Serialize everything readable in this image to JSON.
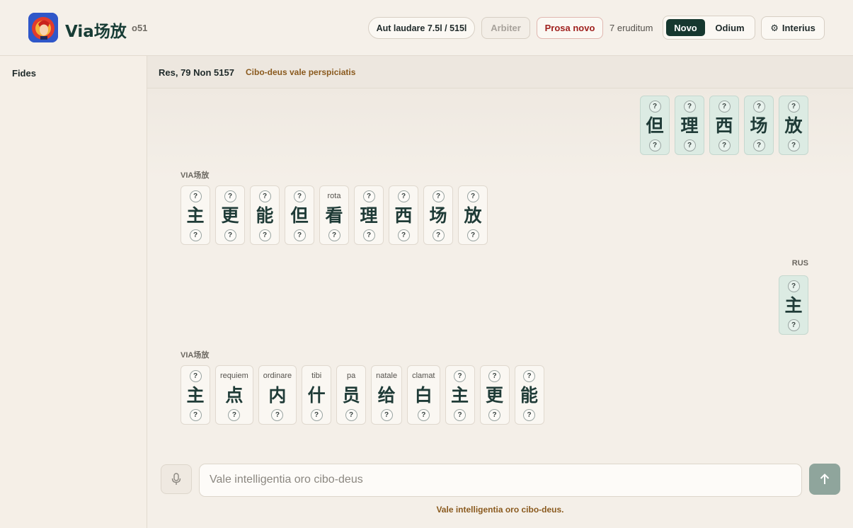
{
  "header": {
    "app_title": "Via场放",
    "version": "o51",
    "quota_label": "Aut laudare 7.5l / 515l",
    "arbiter_label": "Arbiter",
    "prosa_label": "Prosa novo",
    "eruditum_label": "7 eruditum",
    "mode_novo": "Novo",
    "mode_odium": "Odium",
    "interius_label": "Interius",
    "interius_icon": "gear-icon"
  },
  "sidebar": {
    "title": "Fides"
  },
  "conversation": {
    "date": "Res, 79 Non 5157",
    "topic_link": "Cibo-deus vale perspiciatis"
  },
  "messages": [
    {
      "role": "user",
      "speaker": "",
      "tokens": [
        {
          "hanzi": "但",
          "gloss": "?",
          "pinyin": "?"
        },
        {
          "hanzi": "理",
          "gloss": "?",
          "pinyin": "?"
        },
        {
          "hanzi": "西",
          "gloss": "?",
          "pinyin": "?"
        },
        {
          "hanzi": "场",
          "gloss": "?",
          "pinyin": "?"
        },
        {
          "hanzi": "放",
          "gloss": "?",
          "pinyin": "?"
        }
      ]
    },
    {
      "role": "assistant",
      "speaker": "VIA场放",
      "tokens": [
        {
          "hanzi": "主",
          "gloss": "?",
          "pinyin": "?"
        },
        {
          "hanzi": "更",
          "gloss": "?",
          "pinyin": "?"
        },
        {
          "hanzi": "能",
          "gloss": "?",
          "pinyin": "?"
        },
        {
          "hanzi": "但",
          "gloss": "?",
          "pinyin": "?"
        },
        {
          "hanzi": "看",
          "gloss": "rota",
          "pinyin": "?"
        },
        {
          "hanzi": "理",
          "gloss": "?",
          "pinyin": "?"
        },
        {
          "hanzi": "西",
          "gloss": "?",
          "pinyin": "?"
        },
        {
          "hanzi": "场",
          "gloss": "?",
          "pinyin": "?"
        },
        {
          "hanzi": "放",
          "gloss": "?",
          "pinyin": "?"
        }
      ]
    },
    {
      "role": "user",
      "speaker": "RUS",
      "tokens": [
        {
          "hanzi": "主",
          "gloss": "?",
          "pinyin": "?"
        }
      ]
    },
    {
      "role": "assistant",
      "speaker": "VIA场放",
      "tokens": [
        {
          "hanzi": "主",
          "gloss": "?",
          "pinyin": "?"
        },
        {
          "hanzi": "点",
          "gloss": "requiem",
          "pinyin": "?"
        },
        {
          "hanzi": "内",
          "gloss": "ordinare",
          "pinyin": "?"
        },
        {
          "hanzi": "什",
          "gloss": "tibi",
          "pinyin": "?"
        },
        {
          "hanzi": "员",
          "gloss": "pa",
          "pinyin": "?"
        },
        {
          "hanzi": "给",
          "gloss": "natale",
          "pinyin": "?"
        },
        {
          "hanzi": "白",
          "gloss": "clamat",
          "pinyin": "?"
        },
        {
          "hanzi": "主",
          "gloss": "?",
          "pinyin": "?"
        },
        {
          "hanzi": "更",
          "gloss": "?",
          "pinyin": "?"
        },
        {
          "hanzi": "能",
          "gloss": "?",
          "pinyin": "?"
        }
      ]
    }
  ],
  "composer": {
    "placeholder": "Vale intelligentia oro cibo-deus",
    "hint": "Vale intelligentia oro cibo-deus.",
    "mic_icon": "microphone-icon",
    "send_icon": "arrow-up-icon"
  },
  "colors": {
    "primary": "#16382f",
    "accent_warn": "#a0221f",
    "link": "#8a5a1e",
    "user_card": "#dcebe3"
  }
}
